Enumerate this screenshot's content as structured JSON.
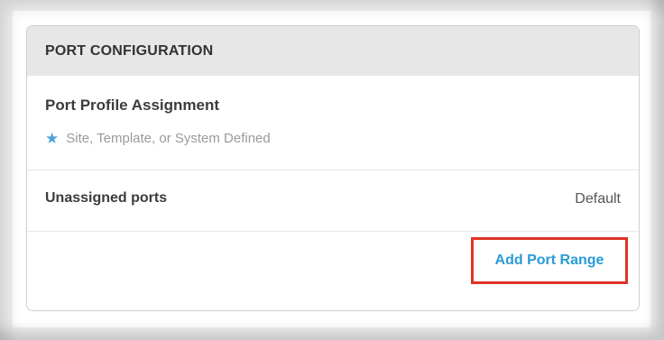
{
  "port_configuration": {
    "header_title": "PORT CONFIGURATION",
    "profile": {
      "title": "Port Profile Assignment",
      "star_icon": "star-icon",
      "subtitle": "Site, Template, or System Defined"
    },
    "unassigned": {
      "label": "Unassigned ports",
      "value": "Default"
    },
    "actions": {
      "add_port_range_label": "Add Port Range"
    }
  },
  "colors": {
    "header_bg": "#e7e7e7",
    "link_blue": "#2a9bd7",
    "star_blue": "#4aa3d8",
    "highlight_red": "#e0332b"
  }
}
